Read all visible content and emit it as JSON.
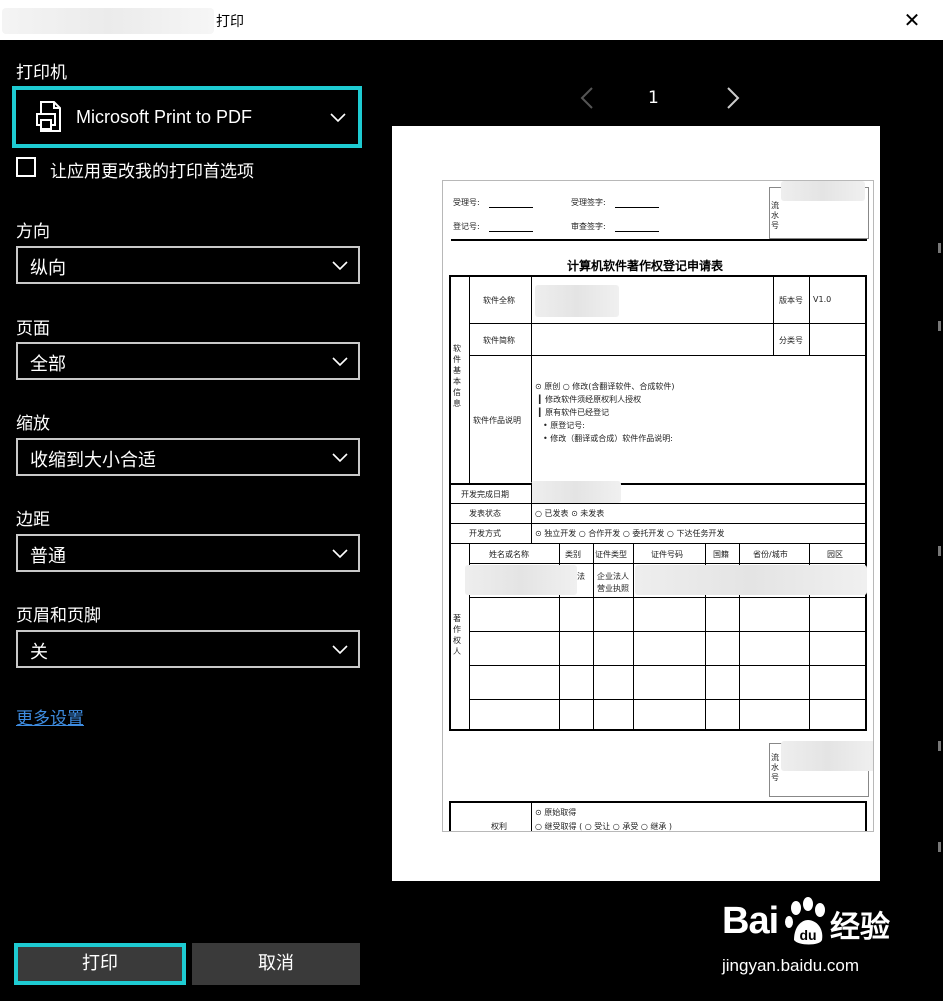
{
  "window": {
    "title": "打印",
    "close_glyph": "✕"
  },
  "printer": {
    "label": "打印机",
    "value": "Microsoft Print to PDF"
  },
  "app_prefs": {
    "label": "让应用更改我的打印首选项",
    "checked": false
  },
  "settings": [
    {
      "label": "方向",
      "value": "纵向"
    },
    {
      "label": "页面",
      "value": "全部"
    },
    {
      "label": "缩放",
      "value": "收缩到大小合适"
    },
    {
      "label": "边距",
      "value": "普通"
    },
    {
      "label": "页眉和页脚",
      "value": "关"
    }
  ],
  "more_settings": "更多设置",
  "buttons": {
    "print": "打印",
    "cancel": "取消"
  },
  "preview": {
    "page_number": "1",
    "doc": {
      "header": {
        "accept_no": "受理号:",
        "accept_sign": "受理签字:",
        "reg_no": "登记号:",
        "review_sign": "审查签字:",
        "serial": "流水号"
      },
      "title": "计算机软件著作权登记申请表",
      "sections": {
        "basic_info": "软件基本信息",
        "owner": "著作权人"
      },
      "rows": {
        "full_name": "软件全称",
        "version_label": "版本号",
        "version_value": "V1.0",
        "short_name": "软件简称",
        "category": "分类号",
        "desc_label": "软件作品说明",
        "desc_lines": [
          "⊙ 原创 ○ 修改(含翻译软件、合成软件)",
          "▎修改软件须经原权利人授权",
          "▎原有软件已经登记",
          "• 原登记号:",
          "• 修改（翻译或合成）软件作品说明:"
        ],
        "dev_date": "开发完成日期",
        "publish_label": "发表状态",
        "publish_value": "○ 已发表 ⊙ 未发表",
        "dev_mode_label": "开发方式",
        "dev_mode_value": "⊙ 独立开发 ○ 合作开发 ○ 委托开发 ○ 下达任务开发"
      },
      "owner_cols": [
        "姓名或名称",
        "类别",
        "证件类型",
        "证件号码",
        "国籍",
        "省份/城市",
        "园区"
      ],
      "owner_cells": {
        "category": "法",
        "id_type_1": "企业法人",
        "id_type_2": "营业执照"
      },
      "footer": {
        "serial": "流水号",
        "rights_label": "权利",
        "rights_line1": "⊙ 原始取得",
        "rights_line2": "○ 继受取得 ( ○ 受让 ○ 承受 ○ 继承 )"
      }
    }
  },
  "watermark": {
    "brand": "Bai",
    "text": "经验",
    "url": "jingyan.baidu.com"
  }
}
